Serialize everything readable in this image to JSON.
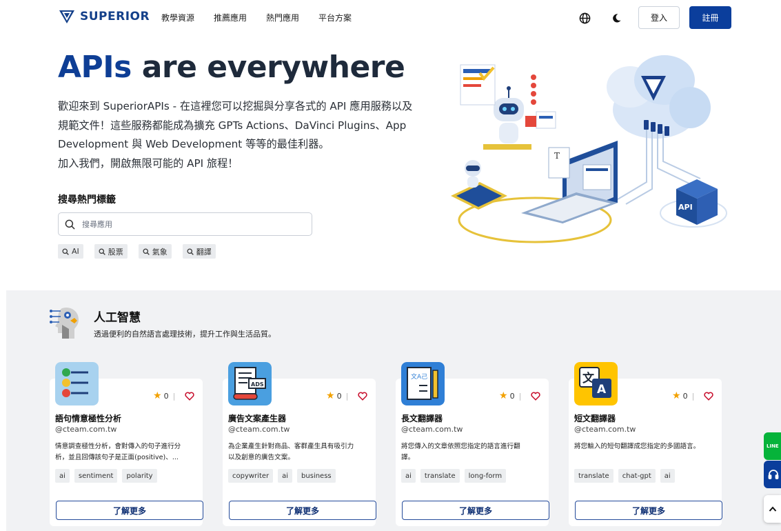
{
  "nav": {
    "logo_text": "SUPERIOR",
    "links": [
      "教學資源",
      "推薦應用",
      "熱門應用",
      "平台方案"
    ],
    "language_icon": "globe-icon",
    "theme_icon": "moon-icon",
    "login": "登入",
    "register": "註冊"
  },
  "hero": {
    "title_accent": "APIs",
    "title_rest": " are everywhere",
    "description_lines": [
      "歡迎來到 SuperiorAPIs - 在這裡您可以挖掘與分享各式的 API 應用服務以及",
      "規範文件！這些服務都能成為擴充 GPTs Actions、DaVinci Plugins、App",
      "Development 與 Web Development 等等的最佳利器。",
      "加入我們，開啟無限可能的 API 旅程！"
    ],
    "illustration_label": "API"
  },
  "search": {
    "heading": "搜尋熱門標籤",
    "placeholder": "搜尋應用",
    "chips": [
      "AI",
      "股票",
      "氣象",
      "翻譯"
    ]
  },
  "section": {
    "title": "人工智慧",
    "subtitle": "透過便利的自然語言處理技術，提升工作與生活品質。",
    "cards": [
      {
        "title": "語句情意極性分析",
        "domain": "@cteam.com.tw",
        "desc_lines": [
          "情意調查極性分析，會對傳入的句子進行分",
          "析，並且回傳該句子是正面(positive)、..."
        ],
        "tags": [
          "ai",
          "sentiment",
          "polarity"
        ],
        "stars": "0",
        "button": "了解更多",
        "icon": "sentiment-list-icon"
      },
      {
        "title": "廣告文案產生器",
        "domain": "@cteam.com.tw",
        "desc_lines": [
          "為企業產生針對商品、客群產生具有吸引力",
          "以及創意的廣告文案。"
        ],
        "tags": [
          "copywriter",
          "ai",
          "business"
        ],
        "stars": "0",
        "button": "了解更多",
        "icon": "ads-document-icon",
        "icon_text": "ADS"
      },
      {
        "title": "長文翻譯器",
        "domain": "@cteam.com.tw",
        "desc_lines": [
          "將您傳入的文章依照您指定的語言進行翻",
          "譯。"
        ],
        "tags": [
          "ai",
          "translate",
          "long-form"
        ],
        "stars": "0",
        "button": "了解更多",
        "icon": "notebook-translate-icon",
        "icon_text": "文A己"
      },
      {
        "title": "短文翻譯器",
        "domain": "@cteam.com.tw",
        "desc_lines": [
          "將您輸入的短句翻譯成您指定的多國語言。"
        ],
        "tags": [
          "translate",
          "chat-gpt",
          "ai"
        ],
        "stars": "0",
        "button": "了解更多",
        "icon": "translate-icon",
        "icon_text_a": "文",
        "icon_text_b": "A"
      }
    ]
  },
  "floating": {
    "line_label": "LINE",
    "support_icon": "headset-icon",
    "top_icon": "chevron-up-icon"
  },
  "colors": {
    "brand": "#0e3e95",
    "register_bg": "#0b3e9c",
    "star": "#f2a100",
    "heart": "#c8102e",
    "line_green": "#06b33a"
  }
}
